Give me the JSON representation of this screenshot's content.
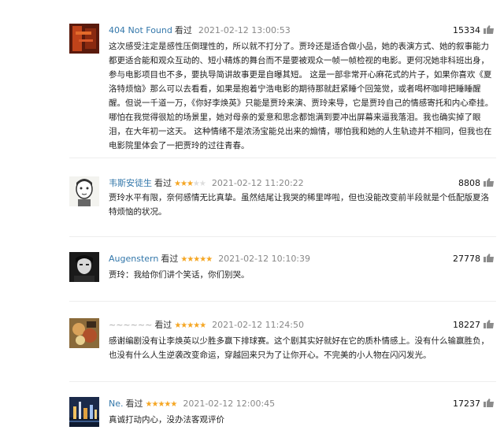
{
  "comments": [
    {
      "user": "404 Not Found",
      "status": "看过",
      "rating": 0,
      "date": "2021-02-12 13:00:53",
      "votes": "15334",
      "text": "这次感受注定是感性压倒理性的，所以就不打分了。贾玲还是适合做小品，她的表演方式、她的叙事能力都更适合能和观众互动的、短小精炼的舞台而不是要被观众一帧一帧检视的电影。更何况她非科班出身，参与电影项目也不多，要执导简讲故事更是自曝其短。 这是一部非常开心麻花式的片子，如果你喜欢《夏洛特烦恼》那么可以去看看，如果是抱着宁浩电影的期待那就赶紧睡个回笼觉，或者喝杯咖啡把睡睡醒醒。但说一千道一万，《你好李焕英》只能是贾玲来演、贾玲来导，它是贾玲自己的情感寄托和内心牵挂。哪怕在我觉得很尬的场景里，她对母亲的爱意和思念都饱满到要冲出屏幕来逼我落泪。我也确实掉了眼泪，在大年初一这天。 这种情绪不是浓汤宝能兑出来的煽情，哪怕我和她的人生轨迹并不相同，但我也在电影院里体会了一把贾玲的过往青春。"
    },
    {
      "user": "韦斯安徒生",
      "status": "看过",
      "rating": 3,
      "date": "2021-02-12 11:20:22",
      "votes": "8808",
      "text": "贾玲水平有限，奈何感情无比真挚。虽然结尾让我哭的稀里哗啦，但也没能改变前半段就是个低配版夏洛特烦恼的状况。"
    },
    {
      "user": "Augenstern",
      "status": "看过",
      "rating": 5,
      "date": "2021-02-12 10:10:39",
      "votes": "27778",
      "text": "贾玲：我给你们讲个笑话，你们别哭。"
    },
    {
      "user": "~~~~~~",
      "status": "看过",
      "rating": 5,
      "date": "2021-02-12 11:24:50",
      "votes": "18227",
      "text": "感谢编剧没有让李焕英以少胜多赢下排球赛。这个剧其实好就好在它的质朴情感上。没有什么输赢胜负，也没有什么人生逆袭改变命运，穿越回来只为了让你开心。不完美的小人物在闪闪发光。"
    },
    {
      "user": "Ne.",
      "status": "看过",
      "rating": 5,
      "date": "2021-02-12 12:00:45",
      "votes": "17237",
      "text": "真诚打动内心，没办法客观评价"
    }
  ],
  "colors": {
    "link": "#3377aa",
    "star": "#f5a623",
    "date": "#888888"
  }
}
